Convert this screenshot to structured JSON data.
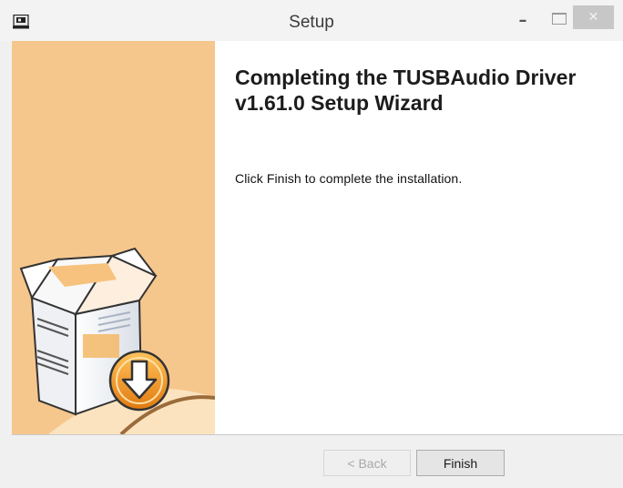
{
  "window": {
    "title": "Setup",
    "minimize_glyph": "–",
    "close_glyph": "✕"
  },
  "wizard": {
    "heading": "Completing the TUSBAudio Driver v1.61.0 Setup Wizard",
    "message": "Click Finish to complete the installation."
  },
  "buttons": {
    "back_label": "< Back",
    "finish_label": "Finish",
    "back_enabled": false
  },
  "icons": {
    "app": "installer-app-icon",
    "banner": "package-box-download-icon"
  },
  "colors": {
    "banner_bg": "#f6c78d",
    "download_badge": "#f39c1f"
  }
}
